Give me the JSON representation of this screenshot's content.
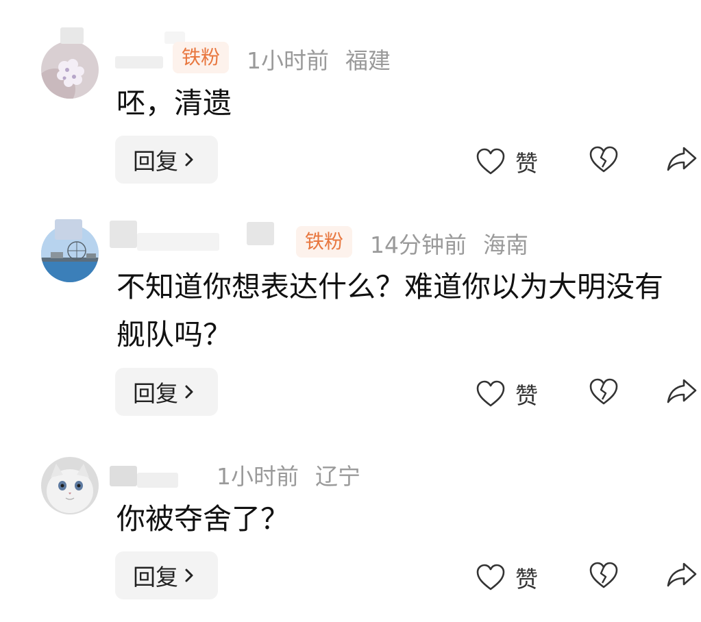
{
  "comments": [
    {
      "badge": "铁粉",
      "time": "1小时前",
      "location": "福建",
      "text": "呸，清遗",
      "reply_label": "回复",
      "like_label": "赞"
    },
    {
      "badge": "铁粉",
      "time": "14分钟前",
      "location": "海南",
      "text": "不知道你想表达什么？难道你以为大明没有舰队吗？",
      "reply_label": "回复",
      "like_label": "赞"
    },
    {
      "time": "1小时前",
      "location": "辽宁",
      "text": "你被夺舍了？",
      "reply_label": "回复",
      "like_label": "赞"
    }
  ],
  "icons": [
    "heart-outline-icon",
    "broken-heart-icon",
    "share-arrow-icon",
    "chevron-right-icon"
  ],
  "colors": {
    "badge_text": "#e8773f",
    "badge_bg": "#fdf2ec",
    "meta": "#9a9a9a",
    "reply_bg": "#f3f3f3"
  }
}
